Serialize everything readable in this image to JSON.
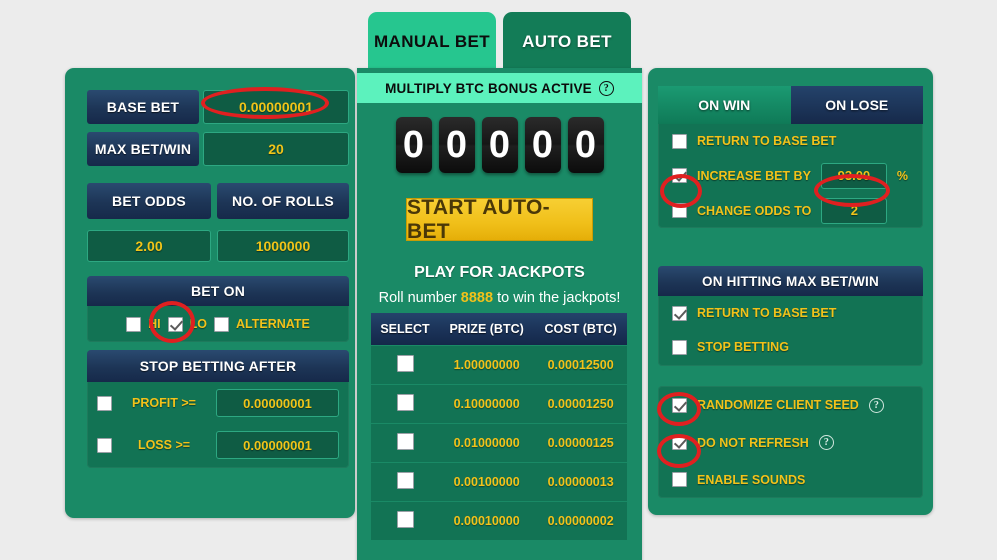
{
  "tabs": {
    "manual": "MANUAL BET",
    "auto": "AUTO BET"
  },
  "bonus": {
    "text": "MULTIPLY BTC BONUS ACTIVE",
    "help": "?"
  },
  "left": {
    "base_bet_label": "BASE BET",
    "base_bet_value": "0.00000001",
    "max_bet_win_label": "MAX BET/WIN",
    "max_bet_win_value": "20",
    "bet_odds_label": "BET ODDS",
    "bet_odds_value": "2.00",
    "no_of_rolls_label": "NO. OF ROLLS",
    "no_of_rolls_value": "1000000",
    "bet_on_label": "BET ON",
    "bet_on_hi": "HI",
    "bet_on_lo": "LO",
    "bet_on_alternate": "ALTERNATE",
    "stop_after_label": "STOP BETTING AFTER",
    "profit_label": "PROFIT >=",
    "profit_value": "0.00000001",
    "loss_label": "LOSS >=",
    "loss_value": "0.00000001"
  },
  "middle": {
    "digits": [
      "0",
      "0",
      "0",
      "0",
      "0"
    ],
    "start_button": "START AUTO-BET",
    "jackpot_title": "PLAY FOR JACKPOTS",
    "jackpot_sub_pre": "Roll number ",
    "jackpot_roll": "8888",
    "jackpot_sub_post": " to win the jackpots!",
    "table_headers": [
      "SELECT",
      "PRIZE (BTC)",
      "COST (BTC)"
    ],
    "table_rows": [
      {
        "prize": "1.00000000",
        "cost": "0.00012500"
      },
      {
        "prize": "0.10000000",
        "cost": "0.00001250"
      },
      {
        "prize": "0.01000000",
        "cost": "0.00000125"
      },
      {
        "prize": "0.00100000",
        "cost": "0.00000013"
      },
      {
        "prize": "0.00010000",
        "cost": "0.00000002"
      }
    ]
  },
  "right": {
    "on_win_tab": "ON WIN",
    "on_lose_tab": "ON LOSE",
    "return_to_base_bet": "RETURN TO BASE BET",
    "increase_bet_by": "INCREASE BET BY",
    "increase_bet_value": "93.00",
    "percent_sign": "%",
    "change_odds_to": "CHANGE ODDS TO",
    "change_odds_value": "2",
    "max_hit_label": "ON HITTING MAX BET/WIN",
    "max_hit_return": "RETURN TO BASE BET",
    "max_hit_stop": "STOP BETTING",
    "randomize_client_seed": "RANDOMIZE CLIENT SEED",
    "do_not_refresh": "DO NOT REFRESH",
    "enable_sounds": "ENABLE SOUNDS",
    "help": "?"
  },
  "colors": {
    "panel_green": "#1a8a66",
    "field_green": "#0f5c44",
    "navy": "#1d3556",
    "gold": "#f2c21a",
    "accent_mint": "#5cf2bd",
    "annotation_red": "#e02020"
  }
}
